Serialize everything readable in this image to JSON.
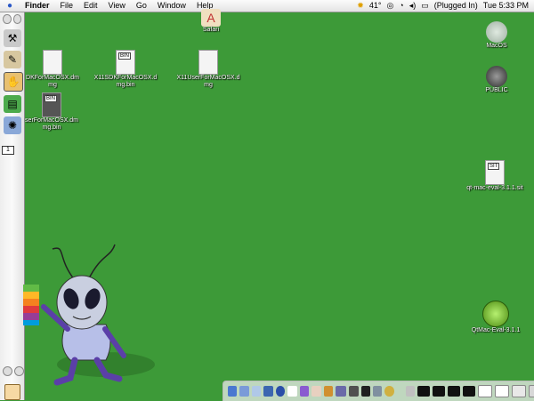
{
  "menubar": {
    "menus": [
      "Finder",
      "File",
      "Edit",
      "View",
      "Go",
      "Window",
      "Help"
    ],
    "temperature": "41°",
    "battery": "(Plugged In)",
    "clock": "Tue 5:33 PM"
  },
  "drawer": {
    "page_number": "1"
  },
  "desktop": {
    "safari": "Safari",
    "file1_line1": "DKForMacOSX.dm",
    "file1_line2": "mg",
    "file2_line1": "X11SDKForMacOSX.d",
    "file2_line2": "mg.bin",
    "file2_tag": "BIN",
    "file3_line1": "X11UserForMacOSX.d",
    "file3_line2": "mg",
    "file4_line1": "serForMacOSX.dm",
    "file4_line2": "mg.bin",
    "file4_tag": "BIN",
    "macos": "MacOS",
    "public": "PUBLIC",
    "qt_archive": "qt-mac-eval-3.1.1.sit",
    "qt_archive_tag": "SIT",
    "qtmac": "QtMac-Eval-3.1.1"
  },
  "colors": {
    "desktop": "#3d9a38",
    "accent": "#2a58c8"
  }
}
